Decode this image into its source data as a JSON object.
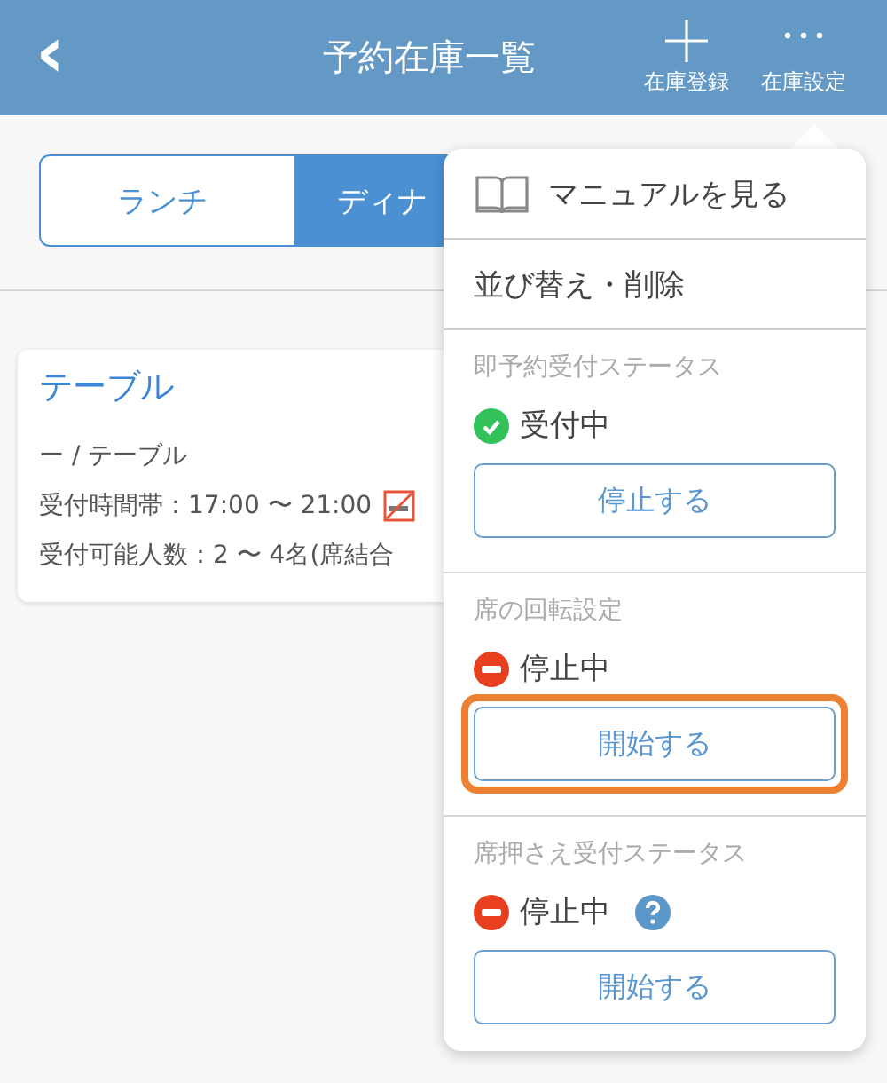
{
  "header": {
    "back": "‹",
    "title": "予約在庫一覧",
    "actions": [
      {
        "kind": "plus",
        "label": "在庫登録"
      },
      {
        "kind": "dots",
        "label": "在庫設定"
      }
    ]
  },
  "segments": [
    {
      "label": "ランチ",
      "selected": false
    },
    {
      "label": "ディナ",
      "selected": true
    }
  ],
  "card": {
    "title": "テーブル",
    "lines": [
      {
        "text": "ー / テーブル"
      },
      {
        "text": "受付時間帯：17:00 〜 21:00",
        "no_smoking": true
      },
      {
        "text": "受付可能人数：2 〜 4名(席結合"
      }
    ]
  },
  "menu": {
    "items": [
      {
        "kind": "manual",
        "label": "マニュアルを見る"
      },
      {
        "kind": "plain",
        "label": "並び替え・削除"
      }
    ],
    "sections": [
      {
        "title": "即予約受付ステータス",
        "accepting": true,
        "status_label": "受付中",
        "button": "停止する",
        "highlighted": false
      },
      {
        "title": "席の回転設定",
        "accepting": false,
        "status_label": "停止中",
        "button": "開始する",
        "highlighted": true
      },
      {
        "title": "席押さえ受付ステータス",
        "accepting": false,
        "status_label": "停止中",
        "help": true,
        "button": "開始する",
        "highlighted": false
      }
    ]
  }
}
